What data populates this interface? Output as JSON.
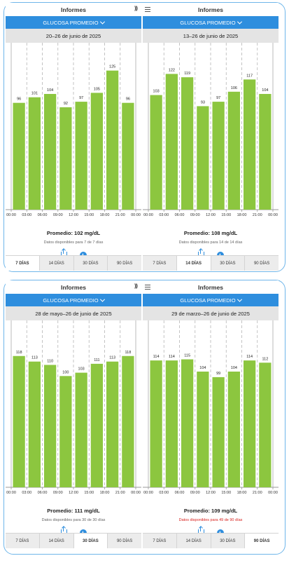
{
  "colors": {
    "accent": "#2e8ede",
    "bar": "#8cc63f",
    "warning": "#d8231f"
  },
  "x_ticks": [
    "00:00",
    "03:00",
    "06:00",
    "09:00",
    "12:00",
    "15:00",
    "18:00",
    "21:00",
    "00:00"
  ],
  "panels": [
    {
      "header_title": "Informes",
      "selector": "GLUCOSA PROMEDIO",
      "date_range": "20–26 de junio de 2025",
      "bars": [
        96,
        101,
        104,
        92,
        97,
        105,
        125,
        96
      ],
      "average": "Promedio: 102 mg/dL",
      "availability": "Datos disponibles para 7 de 7 días",
      "availability_warning": false,
      "tabs": [
        "7 DÍAS",
        "14 DÍAS",
        "30 DÍAS",
        "90 DÍAS"
      ],
      "selected_tab": 0
    },
    {
      "header_title": "Informes",
      "selector": "GLUCOSA PROMEDIO",
      "date_range": "13–26 de junio de 2025",
      "bars": [
        103,
        122,
        119,
        93,
        97,
        106,
        117,
        104
      ],
      "average": "Promedio: 108 mg/dL",
      "availability": "Datos disponibles para 14 de 14 días",
      "availability_warning": false,
      "tabs": [
        "7 DÍAS",
        "14 DÍAS",
        "30 DÍAS",
        "90 DÍAS"
      ],
      "selected_tab": 1
    },
    {
      "header_title": "Informes",
      "selector": "GLUCOSA PROMEDIO",
      "date_range": "28 de mayo–26 de junio de 2025",
      "bars": [
        118,
        113,
        110,
        100,
        103,
        111,
        113,
        118
      ],
      "average": "Promedio: 111 mg/dL",
      "availability": "Datos disponibles para 30 de 30 días",
      "availability_warning": false,
      "tabs": [
        "7 DÍAS",
        "14 DÍAS",
        "30 DÍAS",
        "90 DÍAS"
      ],
      "selected_tab": 2
    },
    {
      "header_title": "Informes",
      "selector": "GLUCOSA PROMEDIO",
      "date_range": "29 de marzo–26 de junio de 2025",
      "bars": [
        114,
        114,
        115,
        104,
        99,
        104,
        114,
        112
      ],
      "average": "Promedio: 109 mg/dL",
      "availability": "Datos disponibles para 49 de 90 días",
      "availability_warning": true,
      "tabs": [
        "7 DÍAS",
        "14 DÍAS",
        "30 DÍAS",
        "90 DÍAS"
      ],
      "selected_tab": 3
    }
  ],
  "chart_data": [
    {
      "type": "bar",
      "title": "GLUCOSA PROMEDIO",
      "categories": [
        "00:00",
        "03:00",
        "06:00",
        "09:00",
        "12:00",
        "15:00",
        "18:00",
        "21:00"
      ],
      "values": [
        96,
        101,
        104,
        92,
        97,
        105,
        125,
        96
      ],
      "ylim": [
        0,
        150
      ]
    },
    {
      "type": "bar",
      "title": "GLUCOSA PROMEDIO",
      "categories": [
        "00:00",
        "03:00",
        "06:00",
        "09:00",
        "12:00",
        "15:00",
        "18:00",
        "21:00"
      ],
      "values": [
        103,
        122,
        119,
        93,
        97,
        106,
        117,
        104
      ],
      "ylim": [
        0,
        150
      ]
    },
    {
      "type": "bar",
      "title": "GLUCOSA PROMEDIO",
      "categories": [
        "00:00",
        "03:00",
        "06:00",
        "09:00",
        "12:00",
        "15:00",
        "18:00",
        "21:00"
      ],
      "values": [
        118,
        113,
        110,
        100,
        103,
        111,
        113,
        118
      ],
      "ylim": [
        0,
        150
      ]
    },
    {
      "type": "bar",
      "title": "GLUCOSA PROMEDIO",
      "categories": [
        "00:00",
        "03:00",
        "06:00",
        "09:00",
        "12:00",
        "15:00",
        "18:00",
        "21:00"
      ],
      "values": [
        114,
        114,
        115,
        104,
        99,
        104,
        114,
        112
      ],
      "ylim": [
        0,
        150
      ]
    }
  ]
}
